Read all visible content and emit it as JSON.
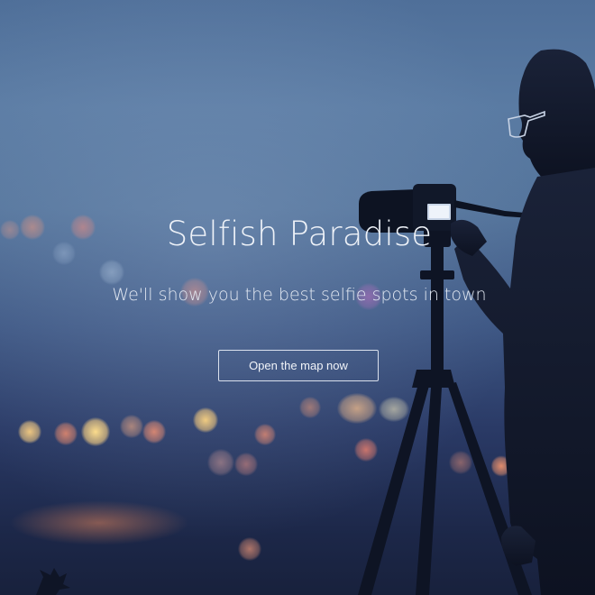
{
  "hero": {
    "title": "Selfish Paradise",
    "subtitle": "We'll show you the best selfie spots in town",
    "cta_label": "Open the map now"
  },
  "background": {
    "description_icon": "photographer-with-camera-on-tripod-silhouette",
    "colors": {
      "sky_top": "#4f6f99",
      "sky_bottom": "#18213c",
      "silhouette": "#0f1526",
      "bokeh_warm": "#f3c27a",
      "bokeh_red": "#e97a5a"
    }
  }
}
